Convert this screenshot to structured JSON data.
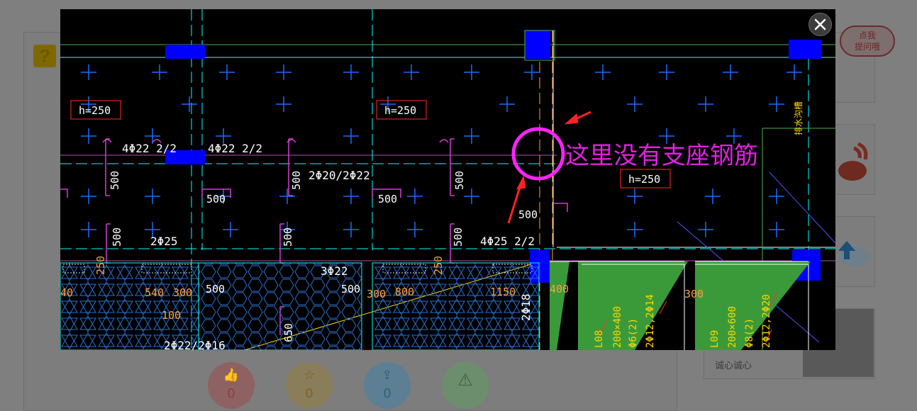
{
  "background": {
    "help_bubble": {
      "line1": "点我",
      "line2": "提问哦"
    },
    "side_caption": "诚心诚心",
    "actions": [
      {
        "name": "like",
        "count": "0"
      },
      {
        "name": "favorite",
        "count": "0"
      },
      {
        "name": "share",
        "count": "0"
      },
      {
        "name": "report",
        "count": ""
      }
    ]
  },
  "drawing": {
    "annotation": "这里没有支座钢筋",
    "slab_labels": [
      "h=250",
      "h=250",
      "h=250"
    ],
    "rebar_labels": [
      "4Φ22 2/2",
      "4Φ22 2/2",
      "2Φ20/2Φ22",
      "2Φ25",
      "4Φ25 2/2",
      "3Φ22",
      "2Φ22/2Φ16",
      "2Φ18"
    ],
    "dimensions": [
      "500",
      "500",
      "500",
      "500",
      "500",
      "500",
      "500",
      "500",
      "500",
      "500",
      "500",
      "540",
      "100",
      "250",
      "250",
      "300",
      "300",
      "800",
      "1150",
      "400",
      "300",
      "650",
      "40"
    ],
    "beam_labels": [
      "L08",
      "200×400",
      "Φ6(2)",
      "2Φ12,2Φ14",
      "L09",
      "200×600",
      "Φ8(2)",
      "2Φ12,2Φ20"
    ],
    "vertical_tag": "排水沟槽",
    "annotation_color": "#e020e0",
    "circle_color": "#ff22ff",
    "arrow_color": "#ff2222"
  }
}
